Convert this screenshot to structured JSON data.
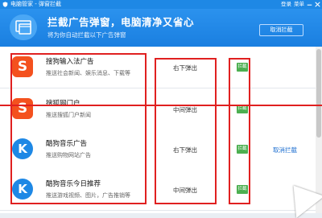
{
  "titlebar": {
    "title": "电脑管家 - 弹窗拦截",
    "links": [
      "登录",
      "菜单"
    ],
    "controls": [
      "minimize",
      "close"
    ]
  },
  "header": {
    "title": "拦截广告弹窗，电脑清净又省心",
    "subtitle": "将为你自动拦截以下广告弹窗",
    "cancel_button": "取消拦截"
  },
  "rows": [
    {
      "name": "搜狗输入法广告",
      "desc": "推送社会新闻、娱乐消息、下载等",
      "position": "右下弹出",
      "status": "拦截",
      "icon": "sogou-icon",
      "action": ""
    },
    {
      "name": "搜狐网门户",
      "desc": "推送搜狐门户新闻",
      "position": "中间弹出",
      "status": "拦截",
      "icon": "sogou-icon",
      "action": ""
    },
    {
      "name": "酷狗音乐广告",
      "desc": "推送购物网站广告",
      "position": "右下弹出",
      "status": "拦截",
      "icon": "kugou-icon",
      "action": "取消拦截"
    },
    {
      "name": "酷狗音乐今日推荐",
      "desc": "推送游戏视频、图片，广告推销等",
      "position": "中间弹出",
      "status": "拦截",
      "icon": "kugou-icon",
      "action": ""
    }
  ],
  "colors": {
    "brand_blue": "#1e88e5",
    "toggle_green": "#4caf50",
    "annotation_red": "#e02020"
  }
}
